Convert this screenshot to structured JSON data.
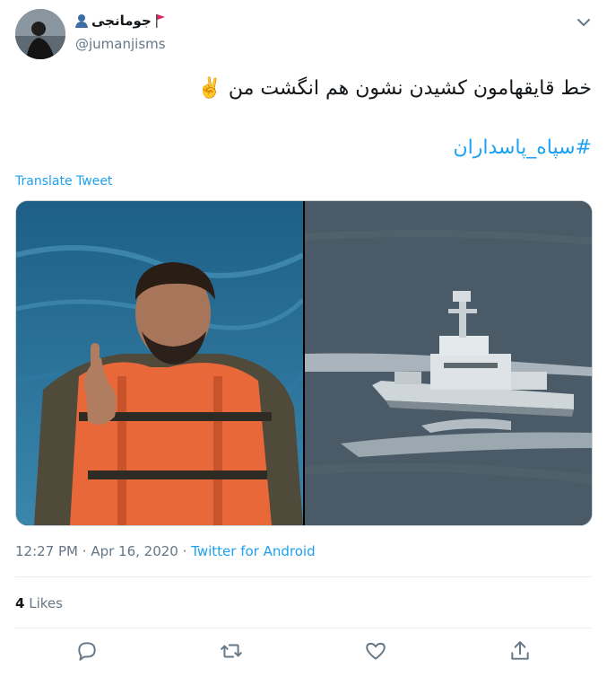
{
  "user": {
    "display_name": "جومانجی",
    "handle": "@jumanjisms",
    "badges": [
      "red-flag-icon",
      "person-silhouette-icon"
    ]
  },
  "tweet": {
    "text": "خط قایقهامون کشیدن  نشون هم انگشت من",
    "emoji": "✌️",
    "hashtag": "#سپاه_پاسداران",
    "translate_label": "Translate Tweet"
  },
  "media": [
    {
      "description_icon": "man-in-life-vest-photo"
    },
    {
      "description_icon": "navy-ship-photo"
    }
  ],
  "meta": {
    "time": "12:27 PM",
    "date": "Apr 16, 2020",
    "source": "Twitter for Android"
  },
  "engagement": {
    "likes_count": "4",
    "likes_label": "Likes"
  },
  "actions": [
    "reply-icon",
    "retweet-icon",
    "like-icon",
    "share-icon"
  ],
  "colors": {
    "accent": "#1da1f2",
    "secondary_text": "#657786",
    "divider": "#e6ecf0"
  }
}
